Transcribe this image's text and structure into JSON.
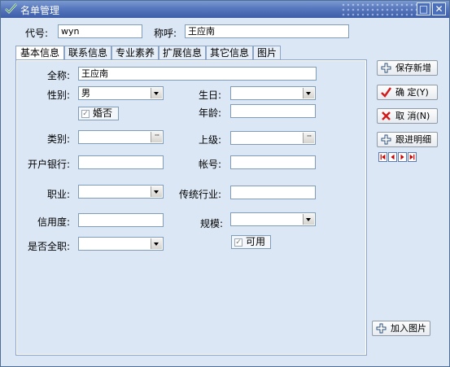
{
  "window": {
    "title": "名单管理",
    "min_label": "□",
    "close_label": "✕"
  },
  "header": {
    "code_label": "代号:",
    "code_value": "wyn",
    "name_label": "称呼:",
    "name_value": "王应南"
  },
  "tabs": [
    "基本信息",
    "联系信息",
    "专业素养",
    "扩展信息",
    "其它信息",
    "图片"
  ],
  "form": {
    "fullname_label": "全称:",
    "fullname_value": "王应南",
    "gender_label": "性别:",
    "gender_value": "男",
    "birthday_label": "生日:",
    "marital_label": "婚否",
    "marital_checked": true,
    "age_label": "年龄:",
    "category_label": "类别:",
    "superior_label": "上级:",
    "bank_label": "开户银行:",
    "account_label": "帐号:",
    "job_label": "职业:",
    "industry_label": "传统行业:",
    "credit_label": "信用度:",
    "scale_label": "规模:",
    "fulltime_label": "是否全职:",
    "available_label": "可用",
    "available_checked": true,
    "ellipsis": "···"
  },
  "buttons": {
    "save_new": "保存新增",
    "ok": "确  定(Y)",
    "cancel": "取 消(N)",
    "follow": "跟进明细",
    "add_image": "加入图片"
  },
  "icons": [
    "check-icon",
    "plus-icon",
    "ok-check-icon",
    "cancel-x-icon",
    "first-record-icon",
    "prev-record-icon",
    "next-record-icon",
    "last-record-icon"
  ],
  "colors": {
    "window_bg": "#dbe7f5",
    "title_bar": "#5677bd",
    "ok_red": "#d11a1a",
    "plus_green": "#2e7d32"
  }
}
